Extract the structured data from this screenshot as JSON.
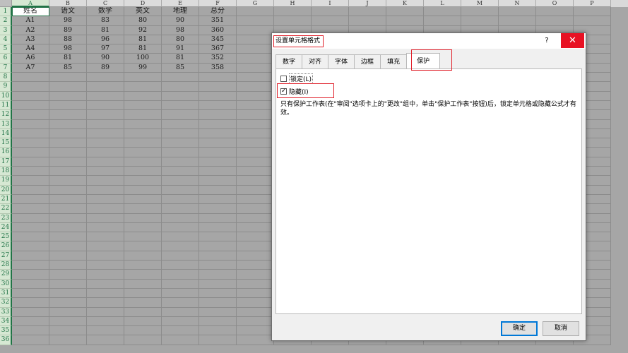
{
  "columns": [
    "A",
    "B",
    "C",
    "D",
    "E",
    "F",
    "G",
    "H",
    "I",
    "J",
    "K",
    "L",
    "M",
    "N",
    "O",
    "P"
  ],
  "selected_column": "A",
  "row_numbers": [
    "1",
    "2",
    "3",
    "4",
    "5",
    "6",
    "7",
    "8",
    "9",
    "10",
    "11",
    "12",
    "13",
    "14",
    "15",
    "16",
    "17",
    "18",
    "19",
    "20",
    "21",
    "22",
    "23",
    "24",
    "25",
    "26",
    "27",
    "28",
    "29",
    "30",
    "31",
    "32",
    "33",
    "34",
    "35",
    "36"
  ],
  "table": {
    "headers": [
      "姓名",
      "语文",
      "数学",
      "英文",
      "地理",
      "总分"
    ],
    "rows": [
      [
        "A1",
        "98",
        "83",
        "80",
        "90",
        "351"
      ],
      [
        "A2",
        "89",
        "81",
        "92",
        "98",
        "360"
      ],
      [
        "A3",
        "88",
        "96",
        "81",
        "80",
        "345"
      ],
      [
        "A4",
        "98",
        "97",
        "81",
        "91",
        "367"
      ],
      [
        "A6",
        "81",
        "90",
        "100",
        "81",
        "352"
      ],
      [
        "A7",
        "85",
        "89",
        "99",
        "85",
        "358"
      ]
    ]
  },
  "dialog": {
    "title": "设置单元格格式",
    "help": "?",
    "close": "✕",
    "tabs": [
      "数字",
      "对齐",
      "字体",
      "边框",
      "填充",
      "保护"
    ],
    "active_tab": "保护",
    "locked": {
      "label": "锁定(L)",
      "checked": false
    },
    "hidden": {
      "label": "隐藏(I)",
      "checked": true
    },
    "note": "只有保护工作表(在\"审阅\"选项卡上的\"更改\"组中，单击\"保护工作表\"按钮)后，锁定单元格或隐藏公式才有效。",
    "ok": "确定",
    "cancel": "取消"
  },
  "colors": {
    "excel_green": "#217346",
    "highlight_red": "#e0202a",
    "close_red": "#e81123",
    "ok_border": "#0078d7"
  }
}
